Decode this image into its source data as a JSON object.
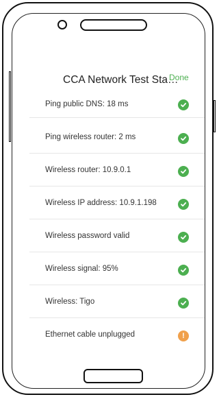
{
  "header": {
    "title": "CCA Network Test Sta…",
    "done_label": "Done"
  },
  "colors": {
    "ok": "#4caf50",
    "warning": "#f0a04b",
    "done": "#4caf50"
  },
  "results": [
    {
      "label": "Ping public DNS: 18 ms",
      "status": "ok",
      "icon": "check-circle-icon"
    },
    {
      "label": "Ping wireless router: 2 ms",
      "status": "ok",
      "icon": "check-circle-icon"
    },
    {
      "label": "Wireless router: 10.9.0.1",
      "status": "ok",
      "icon": "check-circle-icon"
    },
    {
      "label": "Wireless IP address: 10.9.1.198",
      "status": "ok",
      "icon": "check-circle-icon"
    },
    {
      "label": "Wireless password valid",
      "status": "ok",
      "icon": "check-circle-icon"
    },
    {
      "label": "Wireless signal: 95%",
      "status": "ok",
      "icon": "check-circle-icon"
    },
    {
      "label": "Wireless: Tigo",
      "status": "ok",
      "icon": "check-circle-icon"
    },
    {
      "label": "Ethernet cable unplugged",
      "status": "warning",
      "icon": "warning-circle-icon"
    }
  ]
}
